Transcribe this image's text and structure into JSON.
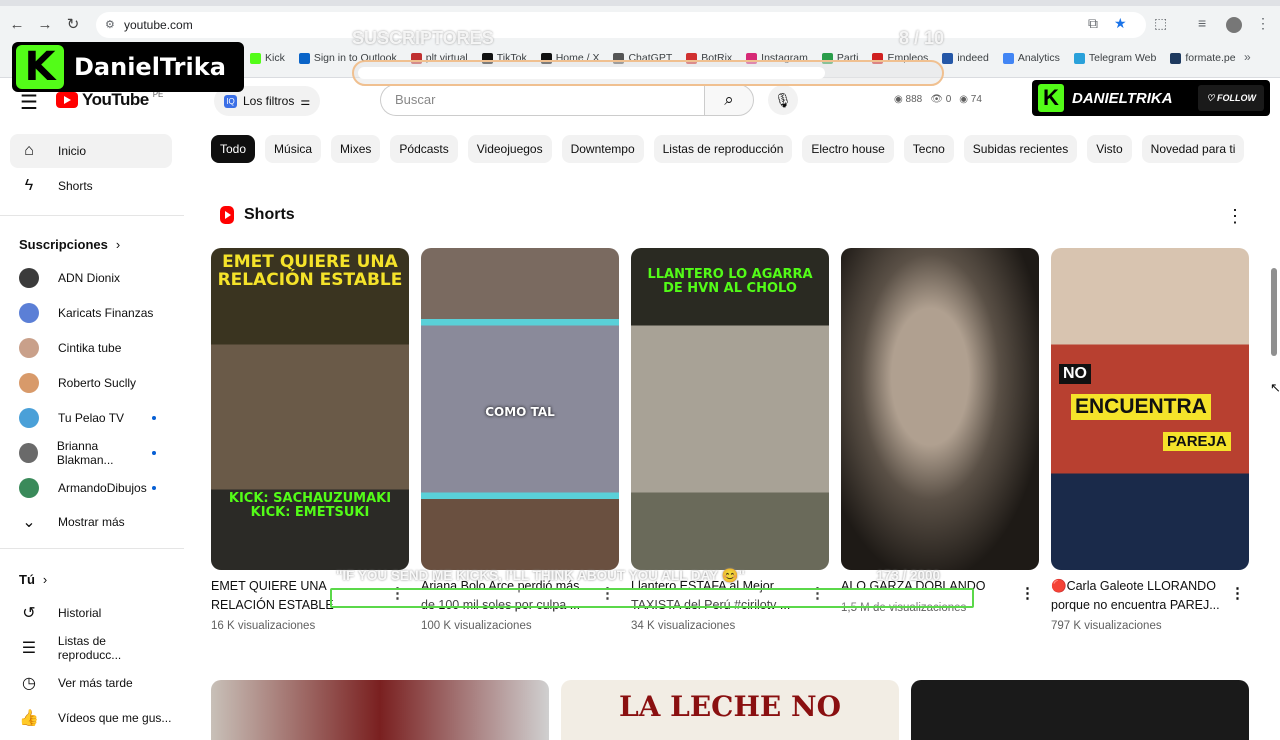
{
  "browser": {
    "url": "youtube.com",
    "bookmarks": [
      {
        "label": "Kick",
        "color": "#53fc18"
      },
      {
        "label": "Sign in to Outlook",
        "color": "#0a64c8"
      },
      {
        "label": "plt virtual",
        "color": "#c03030"
      },
      {
        "label": "TikTok",
        "color": "#111111"
      },
      {
        "label": "Home / X",
        "color": "#111111"
      },
      {
        "label": "ChatGPT",
        "color": "#555555"
      },
      {
        "label": "BotRix",
        "color": "#d03030"
      },
      {
        "label": "Instagram",
        "color": "#d62976"
      },
      {
        "label": "Parti",
        "color": "#2a9d4a"
      },
      {
        "label": "Empleos",
        "color": "#d02020"
      },
      {
        "label": "indeed",
        "color": "#2557a7"
      },
      {
        "label": "Analytics",
        "color": "#4285f4"
      },
      {
        "label": "Telegram Web",
        "color": "#2aa1da"
      },
      {
        "label": "formate.pe",
        "color": "#1e3a5f"
      }
    ]
  },
  "streamer": {
    "logo_letter": "K",
    "name": "DanielTrika"
  },
  "subs_overlay": {
    "label": "SUSCRIPTORES",
    "count": "8 / 10",
    "progress": 0.8
  },
  "header": {
    "logo_text": "YouTube",
    "country": "PE",
    "filters_label": "Los filtros",
    "search_placeholder": "Buscar",
    "stats": [
      "888",
      "0",
      "74"
    ],
    "follow_name": "DANIELTRIKA",
    "follow_label": "FOLLOW"
  },
  "sidebar": {
    "main": [
      {
        "label": "Inicio",
        "icon": "home-icon",
        "glyph": "⌂"
      },
      {
        "label": "Shorts",
        "icon": "shorts-icon",
        "glyph": "ϟ"
      }
    ],
    "subs_header": "Suscripciones",
    "subs": [
      {
        "label": "ADN Dionix",
        "color": "#3b3b3b",
        "dot": false
      },
      {
        "label": "Karicats Finanzas",
        "color": "#5b7fd6",
        "dot": false
      },
      {
        "label": "Cintika tube",
        "color": "#c9a08a",
        "dot": false
      },
      {
        "label": "Roberto Suclly",
        "color": "#d89a6a",
        "dot": false
      },
      {
        "label": "Tu Pelao TV",
        "color": "#4aa0d8",
        "dot": true
      },
      {
        "label": "Brianna Blakman...",
        "color": "#6a6a6a",
        "dot": true
      },
      {
        "label": "ArmandoDibujos",
        "color": "#3a8a5a",
        "dot": true
      }
    ],
    "show_more": "Mostrar más",
    "you_header": "Tú",
    "you": [
      {
        "label": "Historial",
        "glyph": "↺",
        "icon": "history-icon"
      },
      {
        "label": "Listas de reproducc...",
        "glyph": "☰",
        "icon": "playlists-icon"
      },
      {
        "label": "Ver más tarde",
        "glyph": "◷",
        "icon": "watch-later-icon"
      },
      {
        "label": "Vídeos que me gus...",
        "glyph": "👍",
        "icon": "liked-icon"
      }
    ]
  },
  "chips": [
    "Todo",
    "Música",
    "Mixes",
    "Pódcasts",
    "Videojuegos",
    "Downtempo",
    "Listas de reproducción",
    "Electro house",
    "Tecno",
    "Subidas recientes",
    "Visto",
    "Novedad para ti"
  ],
  "shorts": {
    "heading": "Shorts",
    "items": [
      {
        "title": "EMET QUIERE UNA RELACIÓN ESTABLE",
        "views": "16 K visualizaciones",
        "cap_top": "EMET QUIERE UNA RELACIÓN ESTABLE",
        "cap_bottom": "KICK: SACHAUZUMAKI KICK: EMETSUKI"
      },
      {
        "title": "Ariana Bolo Arce perdió más de 100 mil soles por culpa ...",
        "views": "100 K visualizaciones",
        "cap_mid": "COMO TAL"
      },
      {
        "title": "Llantero ESTAFA al Mejor TAXISTA del Perú #cirilotv ...",
        "views": "34 K visualizaciones",
        "cap_top": "LLANTERO LO AGARRA DE HVN AL CHOLO"
      },
      {
        "title": "ALO GARZA DOBLANDO",
        "views": "1,5 M de visualizaciones"
      },
      {
        "title": "🔴Carla Galeote LLORANDO porque no encuentra PAREJ...",
        "views": "797 K visualizaciones",
        "cap_a": "NO",
        "cap_b": "ENCUENTRA",
        "cap_c": "PAREJA"
      }
    ]
  },
  "ticker": {
    "text": "\"IF YOU SEND ME KICKS, I'LL THINK ABOUT YOU ALL DAY 😊\"",
    "count": "173 / 2000",
    "progress": 0.0865
  },
  "bottom_row": [
    {
      "caption": ""
    },
    {
      "caption": "LA LECHE NO"
    },
    {
      "caption": ""
    }
  ],
  "colors": {
    "accent": "#ff0000",
    "kick": "#53fc18",
    "active_chip": "#0f0f0f"
  }
}
